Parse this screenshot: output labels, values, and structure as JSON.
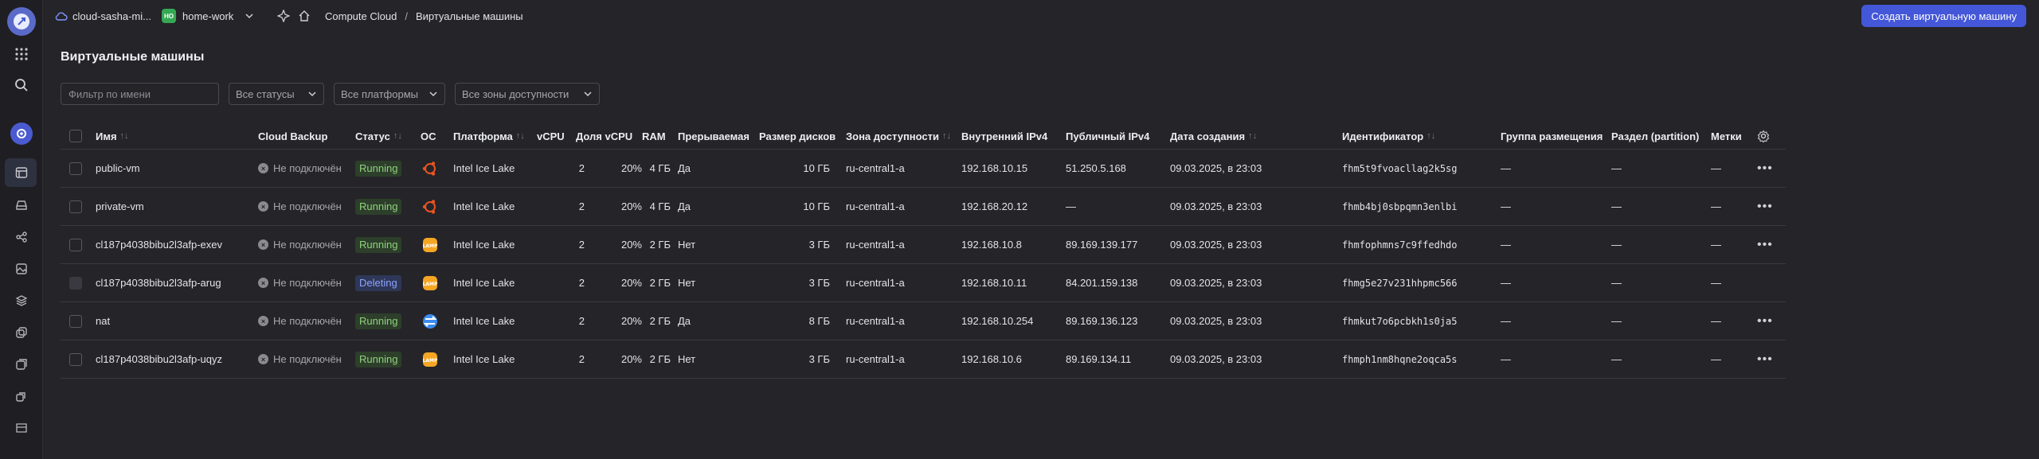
{
  "header": {
    "cloud": "cloud-sasha-mi...",
    "folder_badge": "HO",
    "folder": "home-work",
    "service": "Compute Cloud",
    "separator": "/",
    "section": "Виртуальные машины",
    "create_button": "Создать виртуальную машину"
  },
  "page": {
    "title": "Виртуальные машины"
  },
  "filters": {
    "name_placeholder": "Фильтр по имени",
    "status": "Все статусы",
    "platform": "Все платформы",
    "zone": "Все зоны доступности"
  },
  "columns": {
    "name": "Имя",
    "backup": "Cloud Backup",
    "status": "Статус",
    "os": "ОС",
    "platform": "Платформа",
    "vcpu": "vCPU",
    "vcpu_share": "Доля vCPU",
    "ram": "RAM",
    "preemptible": "Прерываемая",
    "disk": "Размер дисков",
    "zone": "Зона доступности",
    "internal_ip": "Внутренний IPv4",
    "public_ip": "Публичный IPv4",
    "created": "Дата создания",
    "id": "Идентификатор",
    "placement": "Группа размещения",
    "partition": "Раздел (partition)",
    "labels": "Метки"
  },
  "colors": {
    "accent": "#4457d8",
    "running": "#8fd27e",
    "deleting": "#8ea2ff"
  },
  "rows": [
    {
      "name": "public-vm",
      "backup": "Не подключён",
      "status": "Running",
      "status_kind": "running",
      "os": "ubuntu-icon",
      "platform": "Intel Ice Lake",
      "vcpu": "2",
      "vcpu_share": "20%",
      "ram": "4 ГБ",
      "preemptible": "Да",
      "disk": "10 ГБ",
      "zone": "ru-central1-a",
      "internal_ip": "192.168.10.15",
      "public_ip": "51.250.5.168",
      "created": "09.03.2025, в 23:03",
      "id": "fhm5t9fvoacllag2k5sg",
      "placement": "—",
      "partition": "—",
      "labels": "—",
      "menu": "•••"
    },
    {
      "name": "private-vm",
      "backup": "Не подключён",
      "status": "Running",
      "status_kind": "running",
      "os": "ubuntu-icon",
      "platform": "Intel Ice Lake",
      "vcpu": "2",
      "vcpu_share": "20%",
      "ram": "4 ГБ",
      "preemptible": "Да",
      "disk": "10 ГБ",
      "zone": "ru-central1-a",
      "internal_ip": "192.168.20.12",
      "public_ip": "—",
      "created": "09.03.2025, в 23:03",
      "id": "fhmb4bj0sbpqmn3enlbi",
      "placement": "—",
      "partition": "—",
      "labels": "—",
      "menu": "•••"
    },
    {
      "name": "cl187p4038bibu2l3afp-exev",
      "backup": "Не подключён",
      "status": "Running",
      "status_kind": "running",
      "os": "lamp-icon",
      "platform": "Intel Ice Lake",
      "vcpu": "2",
      "vcpu_share": "20%",
      "ram": "2 ГБ",
      "preemptible": "Нет",
      "disk": "3 ГБ",
      "zone": "ru-central1-a",
      "internal_ip": "192.168.10.8",
      "public_ip": "89.169.139.177",
      "created": "09.03.2025, в 23:03",
      "id": "fhmfophmns7c9ffedhdo",
      "placement": "—",
      "partition": "—",
      "labels": "—",
      "menu": "•••"
    },
    {
      "name": "cl187p4038bibu2l3afp-arug",
      "backup": "Не подключён",
      "status": "Deleting",
      "status_kind": "deleting",
      "os": "lamp-icon",
      "platform": "Intel Ice Lake",
      "vcpu": "2",
      "vcpu_share": "20%",
      "ram": "2 ГБ",
      "preemptible": "Нет",
      "disk": "3 ГБ",
      "zone": "ru-central1-a",
      "internal_ip": "192.168.10.11",
      "public_ip": "84.201.159.138",
      "created": "09.03.2025, в 23:03",
      "id": "fhmg5e27v231hhpmc566",
      "placement": "—",
      "partition": "—",
      "labels": "—",
      "menu": ""
    },
    {
      "name": "nat",
      "backup": "Не подключён",
      "status": "Running",
      "status_kind": "running",
      "os": "nat-instance-icon",
      "platform": "Intel Ice Lake",
      "vcpu": "2",
      "vcpu_share": "20%",
      "ram": "2 ГБ",
      "preemptible": "Да",
      "disk": "8 ГБ",
      "zone": "ru-central1-a",
      "internal_ip": "192.168.10.254",
      "public_ip": "89.169.136.123",
      "created": "09.03.2025, в 23:03",
      "id": "fhmkut7o6pcbkh1s0ja5",
      "placement": "—",
      "partition": "—",
      "labels": "—",
      "menu": "•••"
    },
    {
      "name": "cl187p4038bibu2l3afp-uqyz",
      "backup": "Не подключён",
      "status": "Running",
      "status_kind": "running",
      "os": "lamp-icon",
      "platform": "Intel Ice Lake",
      "vcpu": "2",
      "vcpu_share": "20%",
      "ram": "2 ГБ",
      "preemptible": "Нет",
      "disk": "3 ГБ",
      "zone": "ru-central1-a",
      "internal_ip": "192.168.10.6",
      "public_ip": "89.169.134.11",
      "created": "09.03.2025, в 23:03",
      "id": "fhmph1nm8hqne2oqca5s",
      "placement": "—",
      "partition": "—",
      "labels": "—",
      "menu": "•••"
    }
  ]
}
